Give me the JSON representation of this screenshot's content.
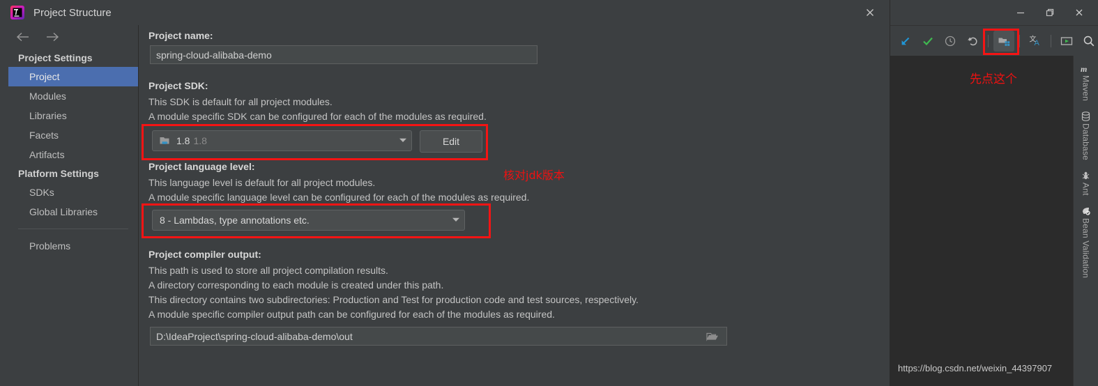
{
  "dialog": {
    "title": "Project Structure",
    "logo_icon": "intellij-idea-logo-icon",
    "close_icon": "close-icon",
    "nav": {
      "back_icon": "arrow-left-icon",
      "forward_icon": "arrow-right-icon"
    }
  },
  "sidebar": {
    "groups": [
      {
        "label": "Project Settings",
        "items": [
          {
            "label": "Project",
            "selected": true
          },
          {
            "label": "Modules",
            "selected": false
          },
          {
            "label": "Libraries",
            "selected": false
          },
          {
            "label": "Facets",
            "selected": false
          },
          {
            "label": "Artifacts",
            "selected": false
          }
        ]
      },
      {
        "label": "Platform Settings",
        "items": [
          {
            "label": "SDKs",
            "selected": false
          },
          {
            "label": "Global Libraries",
            "selected": false
          }
        ]
      }
    ],
    "problems": {
      "label": "Problems"
    }
  },
  "main": {
    "project_name": {
      "label": "Project name:",
      "value": "spring-cloud-alibaba-demo"
    },
    "project_sdk": {
      "label": "Project SDK:",
      "desc_line1": "This SDK is default for all project modules.",
      "desc_line2": "A module specific SDK can be configured for each of the modules as required.",
      "value": "1.8",
      "value_suffix": "1.8",
      "sdk_icon": "jdk-folder-icon",
      "caret_icon": "chevron-down-icon",
      "edit_button": "Edit"
    },
    "language_level": {
      "label": "Project language level:",
      "desc_line1": "This language level is default for all project modules.",
      "desc_line2": "A module specific language level can be configured for each of the modules as required.",
      "value": "8 - Lambdas, type annotations etc.",
      "caret_icon": "chevron-down-icon"
    },
    "compiler_output": {
      "label": "Project compiler output:",
      "desc_line1": "This path is used to store all project compilation results.",
      "desc_line2": "A directory corresponding to each module is created under this path.",
      "desc_line3": "This directory contains two subdirectories: Production and Test for production code and test sources, respectively.",
      "desc_line4": "A module specific compiler output path can be configured for each of the modules as required.",
      "value": "D:\\IdeaProject\\spring-cloud-alibaba-demo\\out",
      "browse_icon": "folder-open-icon"
    }
  },
  "ide": {
    "window_controls": {
      "minimize_icon": "minimize-icon",
      "restore_icon": "restore-icon",
      "close_icon": "close-icon"
    },
    "toolbar": [
      {
        "name": "jump-to-source-icon",
        "label": ""
      },
      {
        "name": "check-icon",
        "label": ""
      },
      {
        "name": "clock-icon",
        "label": ""
      },
      {
        "name": "undo-icon",
        "label": ""
      },
      {
        "name": "project-structure-icon",
        "label": ""
      },
      {
        "name": "translate-icon",
        "label": ""
      },
      {
        "name": "run-icon",
        "label": ""
      },
      {
        "name": "search-icon",
        "label": ""
      }
    ],
    "tool_tabs": [
      {
        "label": "Maven",
        "icon": "maven-icon"
      },
      {
        "label": "Database",
        "icon": "database-icon"
      },
      {
        "label": "Ant",
        "icon": "ant-icon"
      },
      {
        "label": "Bean Validation",
        "icon": "bean-validation-icon"
      }
    ],
    "watermark": "https://blog.csdn.net/weixin_44397907"
  },
  "annotations": {
    "toolbar_note": "先点这个",
    "jdk_note": "核对jdk版本",
    "color": "#f41414"
  }
}
